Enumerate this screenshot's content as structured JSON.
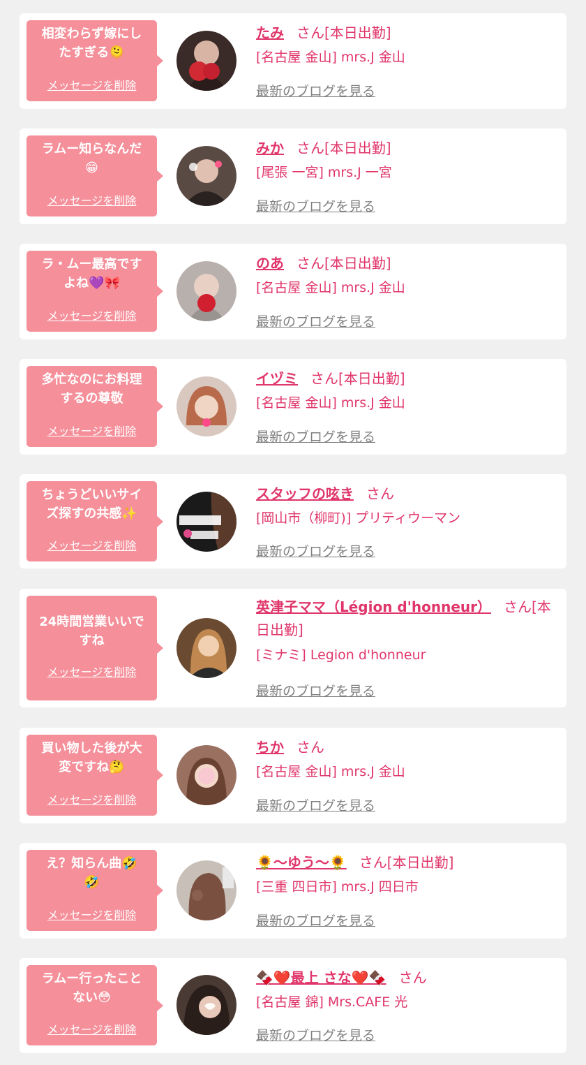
{
  "entries": [
    {
      "message": "相変わらず嫁にし\nたすぎる🫠",
      "delete_label": "メッセージを削除",
      "name": "たみ",
      "suffix": "さん[本日出勤]",
      "store": "[名古屋 金山] mrs.J 金山",
      "blog_link": "最新のブログを見る",
      "avatar_icon": "avatar-photo-icon",
      "avatar_color": "#3a2a28"
    },
    {
      "message": "ラムー知らなんだ\n😁",
      "delete_label": "メッセージを削除",
      "name": "みか",
      "suffix": "さん[本日出勤]",
      "store": "[尾張 一宮] mrs.J 一宮",
      "blog_link": "最新のブログを見る",
      "avatar_icon": "avatar-photo-icon",
      "avatar_color": "#5a4a44"
    },
    {
      "message": "ラ・ムー最高です\nよね💜🎀",
      "delete_label": "メッセージを削除",
      "name": "のあ",
      "suffix": "さん[本日出勤]",
      "store": "[名古屋 金山] mrs.J 金山",
      "blog_link": "最新のブログを見る",
      "avatar_icon": "avatar-photo-icon",
      "avatar_color": "#b8b0ac"
    },
    {
      "message": "多忙なのにお料理\nするの尊敬",
      "delete_label": "メッセージを削除",
      "name": "イヅミ",
      "suffix": "さん[本日出勤]",
      "store": "[名古屋 金山] mrs.J 金山",
      "blog_link": "最新のブログを見る",
      "avatar_icon": "avatar-photo-icon",
      "avatar_color": "#c48a6a"
    },
    {
      "message": "ちょうどいいサイ\nズ探すの共感✨",
      "delete_label": "メッセージを削除",
      "name": "スタッフの呟き",
      "suffix": "さん",
      "store": "[岡山市（柳町)] プリティウーマン",
      "blog_link": "最新のブログを見る",
      "avatar_icon": "avatar-logo-icon",
      "avatar_color": "#1a1a1a"
    },
    {
      "message": "24時間営業いいで\nすね",
      "delete_label": "メッセージを削除",
      "name": "英津子ママ（Légion d'honneur）",
      "suffix": "さん[本日出勤]",
      "store": "[ミナミ] Legion d'honneur",
      "blog_link": "最新のブログを見る",
      "avatar_icon": "avatar-photo-icon",
      "avatar_color": "#6a4a30"
    },
    {
      "message": "買い物した後が大\n変ですね🤔",
      "delete_label": "メッセージを削除",
      "name": "ちか",
      "suffix": "さん",
      "store": "[名古屋 金山] mrs.J 金山",
      "blog_link": "最新のブログを見る",
      "avatar_icon": "avatar-photo-icon",
      "avatar_color": "#9a7060"
    },
    {
      "message": "え？知らん曲🤣\n🤣",
      "delete_label": "メッセージを削除",
      "name": "🌻〜ゆう〜🌻",
      "suffix": "さん[本日出勤]",
      "store": "[三重 四日市] mrs.J 四日市",
      "blog_link": "最新のブログを見る",
      "avatar_icon": "avatar-photo-icon",
      "avatar_color": "#7a6050"
    },
    {
      "message": "ラムー行ったこと\nない😳",
      "delete_label": "メッセージを削除",
      "name": "🍫❤️最上 さな❤️🍫",
      "suffix": "さん",
      "store": "[名古屋 錦] Mrs.CAFE 光",
      "blog_link": "最新のブログを見る",
      "avatar_icon": "avatar-photo-icon",
      "avatar_color": "#4a3a34"
    }
  ]
}
